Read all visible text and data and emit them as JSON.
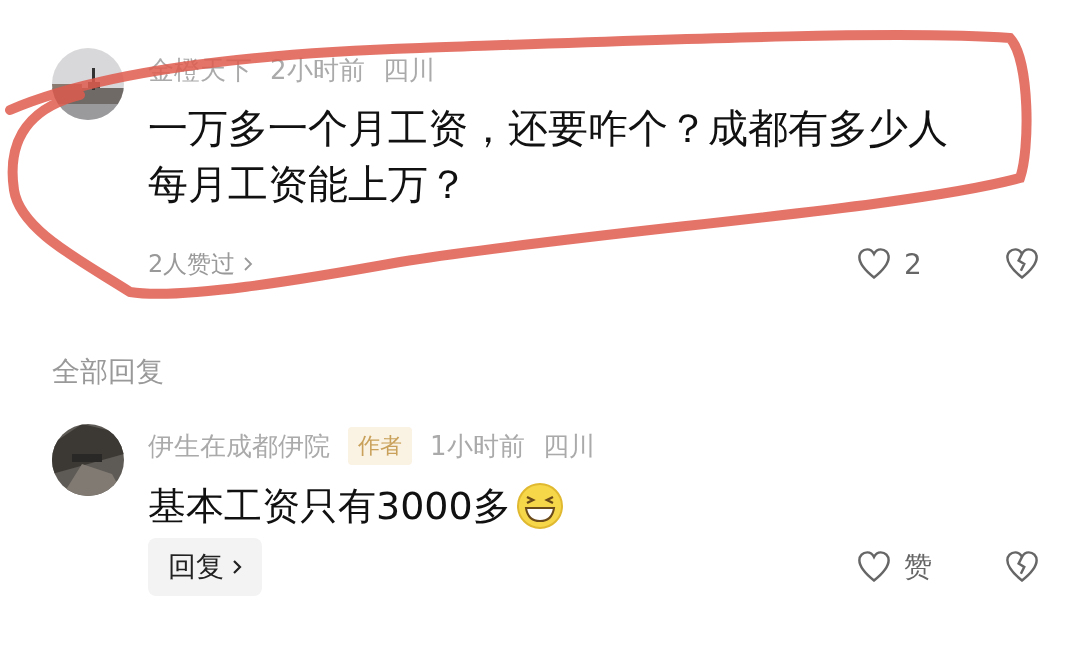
{
  "comment": {
    "author": "金橙天下",
    "time": "2小时前",
    "location": "四川",
    "text": "一万多一个月工资，还要咋个？成都有多少人每月工资能上万？",
    "likers": "2人赞过",
    "like_count": "2"
  },
  "replies_heading": "全部回复",
  "replies": [
    {
      "author": "伊生在成都伊院",
      "badge": "作者",
      "time": "1小时前",
      "location": "四川",
      "text": "基本工资只有3000多",
      "reply_button": "回复",
      "like_label": "赞"
    }
  ]
}
